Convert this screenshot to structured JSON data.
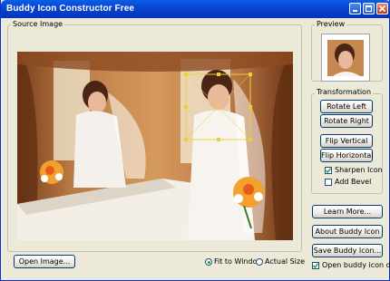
{
  "window": {
    "title": "Buddy Icon Constructor Free"
  },
  "source_image": {
    "legend": "Source Image"
  },
  "preview": {
    "legend": "Preview"
  },
  "transformation": {
    "legend": "Transformation",
    "rotate_left": "Rotate Left",
    "rotate_right": "Rotate Right",
    "flip_vertical": "Flip Vertical",
    "flip_horizontal": "Flip Horizontal",
    "sharpen_icon": {
      "label": "Sharpen Icon",
      "checked": true
    },
    "add_bevel": {
      "label": "Add Bevel",
      "checked": false
    }
  },
  "buttons": {
    "learn_more": "Learn More...",
    "about": "About Buddy Icon",
    "save": "Save Buddy Icon...",
    "open_image": "Open Image..."
  },
  "view_mode": {
    "fit_to_window": {
      "label": "Fit to Window",
      "selected": true
    },
    "actual_size": {
      "label": "Actual Size",
      "selected": false
    }
  },
  "open_dialog": {
    "label": "Open buddy icon dialog",
    "checked": true
  },
  "colors": {
    "title_bar": "#0845d3",
    "window_bg": "#ece9d8",
    "close_button": "#c3401e",
    "crop_box": "#e8d23a"
  }
}
